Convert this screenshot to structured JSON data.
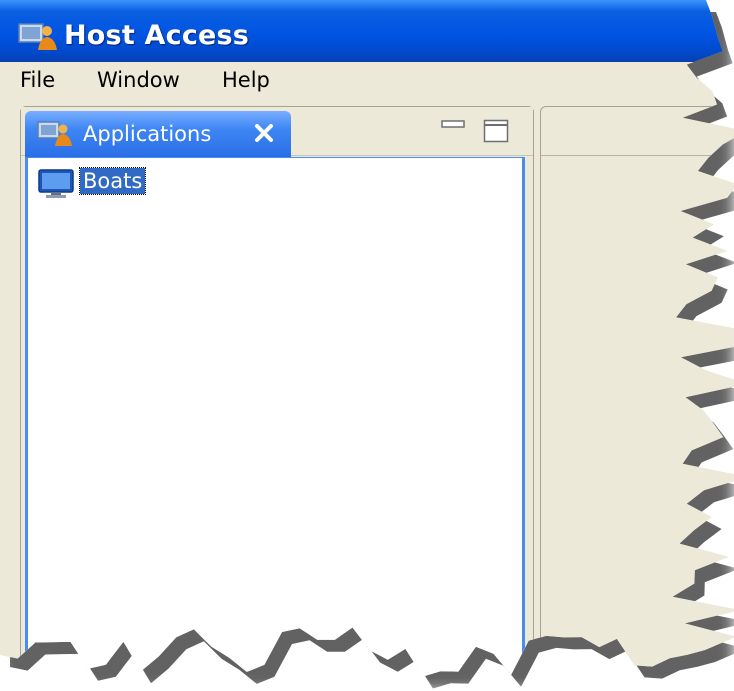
{
  "window": {
    "title": "Host Access"
  },
  "menubar": {
    "items": [
      "File",
      "Window",
      "Help"
    ]
  },
  "applications_view": {
    "tab_label": "Applications",
    "tree": [
      {
        "label": "Boats",
        "icon": "monitor-icon",
        "selected": true
      }
    ]
  },
  "colors": {
    "title_bar": "#0054e3",
    "menu_background": "#ece9d8",
    "active_tab": "#3e86f4",
    "selection": "#316ac5",
    "pane_border": "#4a8cf0"
  }
}
